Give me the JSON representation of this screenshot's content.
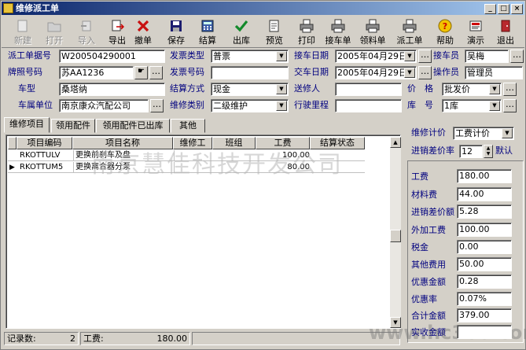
{
  "window": {
    "title": "维修派工单"
  },
  "toolbar": [
    {
      "label": "新建",
      "icon": "new-doc-icon",
      "disabled": true
    },
    {
      "label": "打开",
      "icon": "open-folder-icon",
      "disabled": true
    },
    {
      "label": "导入",
      "icon": "import-icon",
      "disabled": true
    },
    {
      "label": "导出",
      "icon": "export-icon",
      "disabled": false
    },
    {
      "label": "撤单",
      "icon": "red-x-icon",
      "disabled": false
    },
    {
      "label": "保存",
      "icon": "floppy-disk-icon",
      "disabled": false
    },
    {
      "label": "结算",
      "icon": "calculator-icon",
      "disabled": false
    },
    {
      "label": "出库",
      "icon": "green-check-icon",
      "disabled": false
    },
    {
      "label": "预览",
      "icon": "preview-icon",
      "disabled": false
    },
    {
      "label": "打印",
      "icon": "printer-icon",
      "disabled": false
    },
    {
      "label": "接车单",
      "icon": "printer-icon",
      "disabled": false
    },
    {
      "label": "领料单",
      "icon": "printer-icon",
      "disabled": false
    },
    {
      "label": "派工单",
      "icon": "printer-icon",
      "disabled": false
    },
    {
      "label": "帮助",
      "icon": "help-icon",
      "disabled": false
    },
    {
      "label": "演示",
      "icon": "demo-icon",
      "disabled": false
    },
    {
      "label": "退出",
      "icon": "exit-door-icon",
      "disabled": false
    }
  ],
  "form": {
    "order_no_label": "派工单据号",
    "order_no": "W200504290001",
    "plate_label": "牌照号码",
    "plate": "苏AA1236",
    "car_type_label": "车型",
    "car_type": "桑塔纳",
    "car_unit_label": "车属单位",
    "car_unit": "南京康众汽配公司",
    "invoice_type_label": "发票类型",
    "invoice_type": "普票",
    "invoice_no_label": "发票号码",
    "invoice_no": "",
    "settle_method_label": "结算方式",
    "settle_method": "现金",
    "repair_type_label": "维修类别",
    "repair_type": "二级维护",
    "receive_date_label": "接车日期",
    "receive_date": "2005年04月29日",
    "deliver_date_label": "交车日期",
    "deliver_date": "2005年04月29日",
    "sender_label": "送修人",
    "sender": "",
    "mileage_label": "行驶里程",
    "mileage": "",
    "receiver_label": "接车员",
    "receiver": "吴梅",
    "operator_label": "操作员",
    "operator": "管理员",
    "price_label": "价　格",
    "price": "批发价",
    "warehouse_label": "库　号",
    "warehouse": "1库"
  },
  "tabs": [
    "维修项目",
    "领用配件",
    "领用配件已出库",
    "其他"
  ],
  "table": {
    "headers": [
      "项目编码",
      "项目名称",
      "维修工",
      "班组",
      "工费",
      "结算状态"
    ],
    "rows": [
      {
        "code": "RKOTTULV",
        "name": "更换前刹车及盘",
        "worker": "",
        "team": "",
        "fee": "100.00",
        "status": ""
      },
      {
        "code": "RKOTTUM5",
        "name": "更换离合器分泵",
        "worker": "",
        "team": "",
        "fee": "80.00",
        "status": ""
      }
    ]
  },
  "watermark": "南京慧佳科技开发公司",
  "right": {
    "pricing_label": "维修计价",
    "pricing": "工费计价",
    "markup_label": "进销差价率",
    "markup": "12",
    "default_label": "默认",
    "items": [
      {
        "label": "工费",
        "value": "180.00"
      },
      {
        "label": "材料费",
        "value": "44.00"
      },
      {
        "label": "进销差价额",
        "value": "5.28"
      },
      {
        "label": "外加工费",
        "value": "100.00"
      },
      {
        "label": "税金",
        "value": "0.00"
      },
      {
        "label": "其他费用",
        "value": "50.00"
      },
      {
        "label": "优惠金额",
        "value": "0.28"
      },
      {
        "label": "优惠率",
        "value": "0.07%"
      },
      {
        "label": "合计金额",
        "value": "379.00"
      },
      {
        "label": "实收金额",
        "value": ""
      }
    ]
  },
  "status": {
    "records_label": "记录数:",
    "records": "2",
    "fee_label": "工费:",
    "fee": "180.00"
  },
  "brand_watermark": "www.hc360.com"
}
